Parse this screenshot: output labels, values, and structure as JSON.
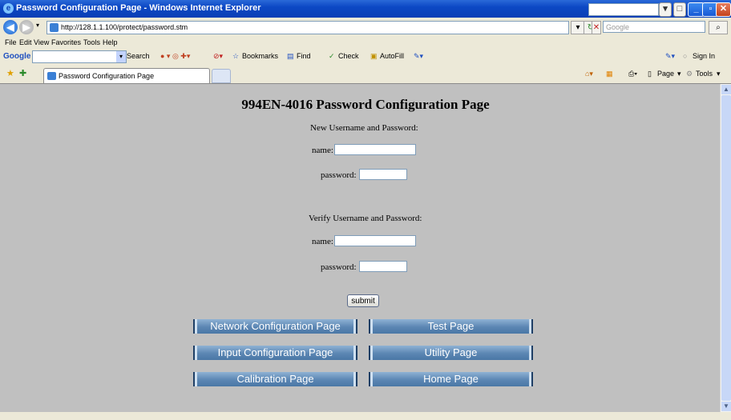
{
  "window": {
    "title": "Password Configuration Page - Windows Internet Explorer"
  },
  "address": {
    "url": "http://128.1.1.100/protect/password.stm",
    "search_placeholder": "Google"
  },
  "menu": [
    "File",
    "Edit",
    "View",
    "Favorites",
    "Tools",
    "Help"
  ],
  "google_toolbar": {
    "logo": "Google",
    "search": "Search",
    "bookmarks": "Bookmarks",
    "find": "Find",
    "check": "Check",
    "autofill": "AutoFill",
    "signin": "Sign In"
  },
  "tab": {
    "title": "Password Configuration Page",
    "page_menu": "Page",
    "tools_menu": "Tools"
  },
  "page": {
    "heading": "994EN-4016 Password Configuration Page",
    "new_section": "New Username and Password:",
    "verify_section": "Verify Username and Password:",
    "name_label": "name:",
    "password_label": "password:",
    "submit_label": "submit",
    "nav_buttons": [
      "Network Configuration Page",
      "Test Page",
      "Input Configuration Page",
      "Utility Page",
      "Calibration Page",
      "Home Page"
    ]
  }
}
